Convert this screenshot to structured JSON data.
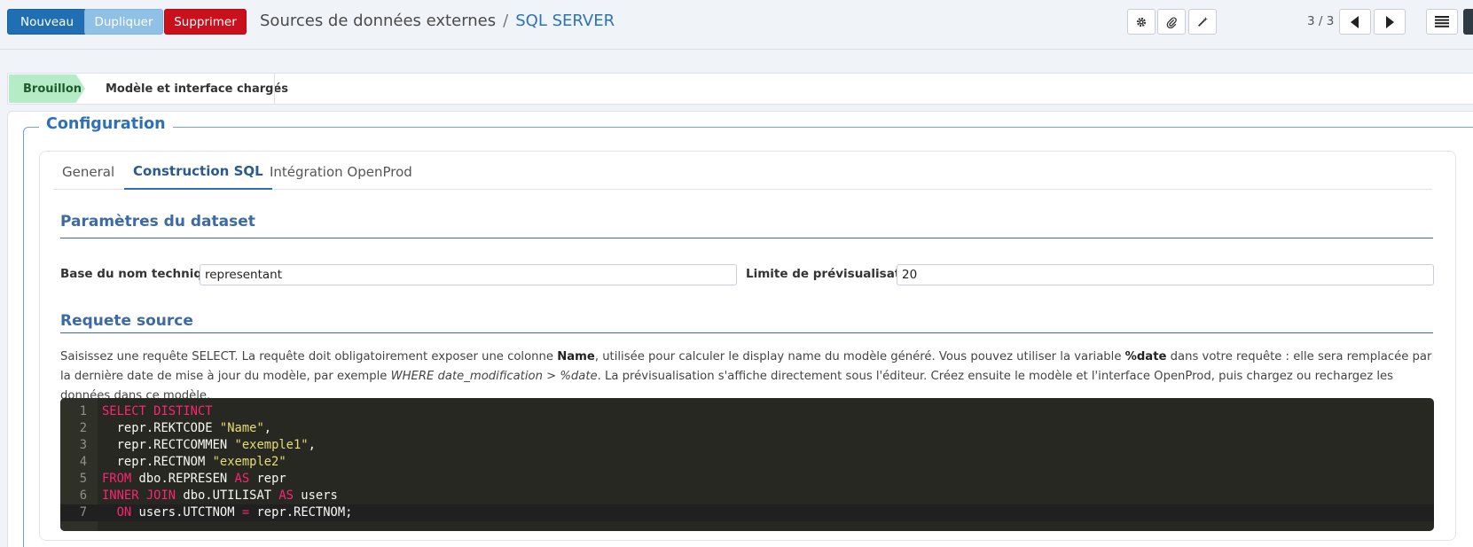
{
  "toolbar": {
    "new_label": "Nouveau",
    "duplicate_label": "Dupliquer",
    "delete_label": "Supprimer",
    "pager": "3 / 3"
  },
  "breadcrumb": {
    "parent": "Sources de données externes",
    "separator": "/",
    "current": "SQL SERVER"
  },
  "icons": {
    "settings": "gear-icon",
    "attachment": "paperclip-icon",
    "wizard": "magic-wand-icon",
    "previous": "caret-left-icon",
    "next": "caret-right-icon",
    "list_view": "list-icon"
  },
  "status": {
    "active_stage": "Brouillon",
    "next_stage": "Modèle et interface chargés"
  },
  "config": {
    "legend": "Configuration",
    "tabs": [
      "General",
      "Construction SQL",
      "Intégration OpenProd"
    ],
    "active_tab": "Construction SQL"
  },
  "dataset": {
    "title": "Paramètres du dataset",
    "base_label": "Base du nom technique",
    "base_value": "representant",
    "limit_label": "Limite de prévisualisation",
    "limit_value": "20"
  },
  "query": {
    "title": "Requete source",
    "help_1": "Saisissez une requête SELECT. La requête doit obligatoirement exposer une colonne ",
    "help_name": "Name",
    "help_2": ", utilisée pour calculer le display name du modèle généré. Vous pouvez utiliser la variable ",
    "help_var": "%date",
    "help_3": " dans votre requête : elle sera remplacée par la dernière date de mise à jour du modèle, par exemple ",
    "help_example": "WHERE date_modification > %date",
    "help_4": ". La prévisualisation s'affiche directement sous l'éditeur. Créez ensuite le modèle et l'interface OpenProd, puis chargez ou rechargez les données dans ce modèle."
  },
  "code": {
    "line_numbers": [
      "1",
      "2",
      "3",
      "4",
      "5",
      "6",
      "7"
    ],
    "l1_kw": "SELECT DISTINCT",
    "l2_pre": "  repr.REKTCODE ",
    "l2_str": "\"Name\"",
    "l2_post": ",",
    "l3_pre": "  repr.RECTCOMMEN ",
    "l3_str": "\"exemple1\"",
    "l3_post": ",",
    "l4_pre": "  repr.RECTNOM ",
    "l4_str": "\"exemple2\"",
    "l5_kw1": "FROM",
    "l5_mid": " dbo.REPRESEN ",
    "l5_kw2": "AS",
    "l5_post": " repr",
    "l6_kw1": "INNER JOIN",
    "l6_mid": " dbo.UTILISAT ",
    "l6_kw2": "AS",
    "l6_post": " users",
    "l7_indent": "  ",
    "l7_kw1": "ON",
    "l7_mid": " users.UTCTNOM ",
    "l7_op": "=",
    "l7_post": " repr.RECTNOM;"
  },
  "colors": {
    "primary": "#1f6fb2",
    "danger": "#c9101b",
    "accent_blue": "#2f6fb5",
    "status_green": "#b6ecc5",
    "editor_bg": "#272822",
    "keyword": "#f92672",
    "string": "#e6db74"
  }
}
